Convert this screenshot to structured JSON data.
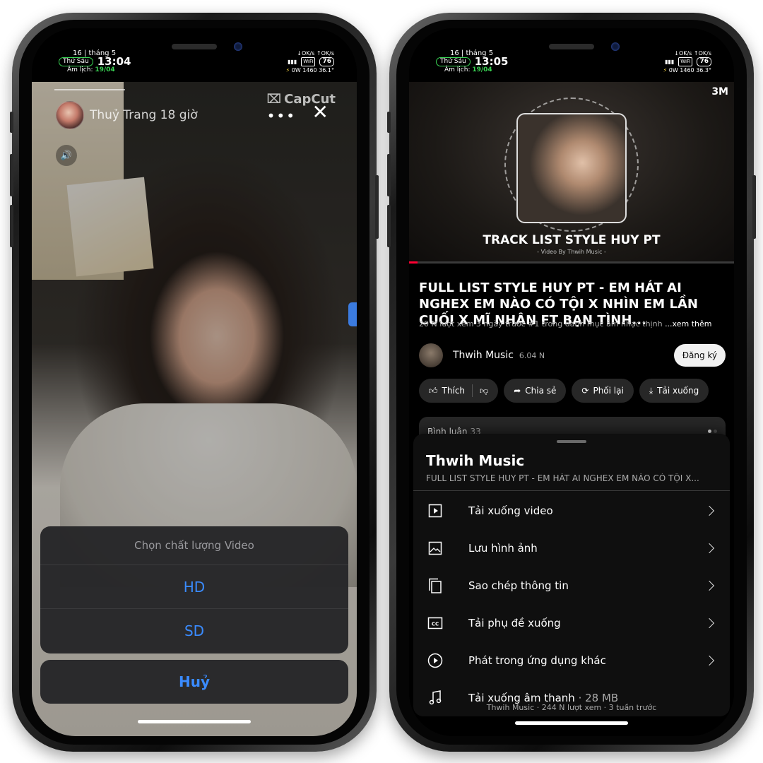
{
  "status_left": {
    "date": "16 | tháng 5",
    "day": "Thứ Sáu",
    "time": "13:04",
    "lunar_label": "Âm lịch:",
    "lunar_date": "19/04",
    "net": "↓OK/s ↑OK/s",
    "wifi": "WiFi",
    "battery": "76",
    "power": "0W",
    "cycles": "1460",
    "temp": "36.1°"
  },
  "status_right": {
    "date": "16 | tháng 5",
    "day": "Thứ Sáu",
    "time": "13:05",
    "lunar_label": "Âm lịch:",
    "lunar_date": "19/04",
    "net": "↓OK/s ↑OK/s",
    "wifi": "WiFi",
    "battery": "76",
    "power": "0W",
    "cycles": "1460",
    "temp": "36.3°"
  },
  "left_screen": {
    "author": "Thuỷ Trang 18 giờ",
    "capcut_label": "CapCut",
    "more_label": "•••",
    "close_label": "✕",
    "sheet": {
      "title": "Chọn chất lượng Video",
      "options": [
        "HD",
        "SD"
      ],
      "cancel": "Huỷ"
    }
  },
  "right_screen": {
    "brand": "3M",
    "hero_title": "TRACK LIST STYLE HUY PT",
    "hero_sub": "- Video By Thwih Music -",
    "video_title": "FULL LIST STYLE HUY PT - EM HÁT AI NGHEX EM NÀO CÓ TỘI X NHÌN EM LẦN CUỐI X MĨ NHÂN FT BẠN TÌNH...",
    "meta": "20 N lượt xem  3 ngày trước  #1 trong danh mục âm nhạc thịnh ",
    "meta_more": "...xem thêm",
    "channel": {
      "name": "Thwih Music",
      "subs": "6.04 N",
      "subscribe": "Đăng ký"
    },
    "actions": {
      "like": "Thích",
      "share": "Chia sẻ",
      "remix": "Phối lại",
      "download": "Tải xuống"
    },
    "comments": {
      "label": "Bình luận",
      "count": "33"
    },
    "sheet": {
      "title": "Thwih Music",
      "subtitle": "FULL LIST STYLE HUY PT - EM HÁT AI NGHEX EM NÀO CÓ TỘI X...",
      "items": [
        {
          "label": "Tải xuống video",
          "icon": "play-box-icon"
        },
        {
          "label": "Lưu hình ảnh",
          "icon": "image-icon"
        },
        {
          "label": "Sao chép thông tin",
          "icon": "copy-icon"
        },
        {
          "label": "Tải phụ đề xuống",
          "icon": "cc-icon"
        },
        {
          "label": "Phát trong ứng dụng khác",
          "icon": "play-circle-icon"
        },
        {
          "label": "Tải xuống âm thanh",
          "size": " · 28 MB",
          "icon": "music-note-icon"
        }
      ]
    },
    "under_text": "Thwih Music · 244 N lượt xem · 3 tuần trước"
  }
}
